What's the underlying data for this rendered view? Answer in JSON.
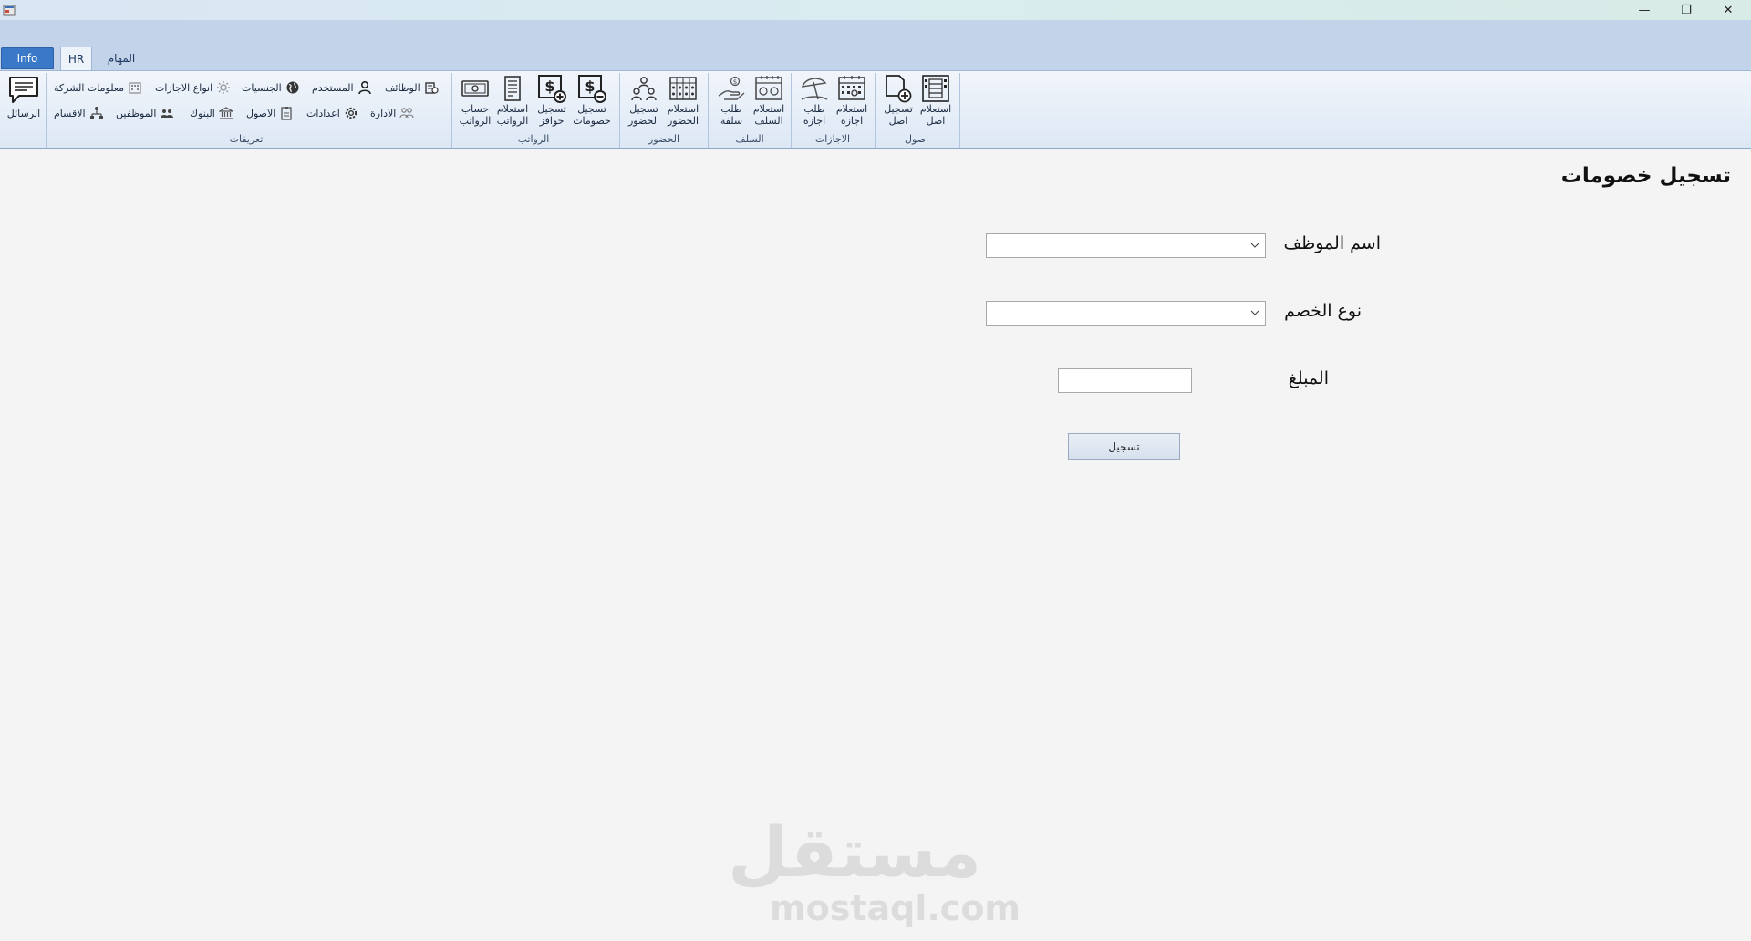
{
  "window": {
    "minimize_glyph": "—",
    "maximize_glyph": "❐",
    "close_glyph": "✕"
  },
  "tabs": {
    "info": "Info",
    "hr": "HR",
    "tasks": "المهام"
  },
  "ribbon": {
    "messages": {
      "label": "الرسائل",
      "icon": "message-icon"
    },
    "groups": {
      "definitions": {
        "label": "تعريفات",
        "row1": [
          "الوظائف",
          "المستخدم",
          "الجنسيات",
          "انواع الاجازات",
          "معلومات الشركة"
        ],
        "row2": [
          "الادارة",
          "اعدادات",
          "الاصول",
          "البنوك",
          "الموظفين",
          "الاقسام"
        ]
      },
      "salaries": {
        "label": "الرواتب",
        "buttons": [
          "حساب الرواتب",
          "استعلام الرواتب",
          "تسجيل حوافز",
          "تسجيل خصومات"
        ]
      },
      "attendance": {
        "label": "الحضور",
        "buttons": [
          "تسجيل الحضور",
          "استعلام الحضور"
        ]
      },
      "advances": {
        "label": "السلف",
        "buttons": [
          "طلب سلفة",
          "استعلام السلف"
        ]
      },
      "leaves": {
        "label": "الاجازات",
        "buttons": [
          "طلب اجازة",
          "استعلام اجازة"
        ]
      },
      "assets": {
        "label": "اصول",
        "buttons": [
          "تسجيل اصل",
          "استعلام اصل"
        ]
      }
    }
  },
  "form": {
    "title": "تسجيل خصومات",
    "employee_label": "اسم الموظف",
    "employee_value": "",
    "deduction_type_label": "نوع الخصم",
    "deduction_type_value": "",
    "amount_label": "المبلغ",
    "amount_value": "",
    "submit_label": "تسجيل"
  },
  "watermark": {
    "arabic": "مستقل",
    "latin": "mostaql.com"
  }
}
